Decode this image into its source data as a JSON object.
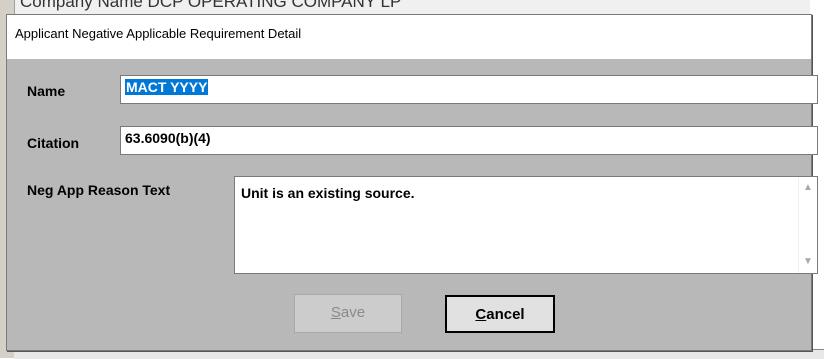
{
  "background": {
    "header_text": "Company Name    DCP OPERATING COMPANY LP"
  },
  "dialog": {
    "title": "Applicant Negative Applicable Requirement Detail",
    "name": {
      "label": "Name",
      "value": "MACT YYYY"
    },
    "citation": {
      "label": "Citation",
      "value": "63.6090(b)(4)"
    },
    "reason": {
      "label": "Neg App Reason Text",
      "value": "Unit is an existing source."
    },
    "buttons": {
      "save": {
        "label": "Save",
        "mnemonic": "S",
        "rest": "ave",
        "enabled": false
      },
      "cancel": {
        "label": "Cancel",
        "mnemonic": "C",
        "rest": "ancel",
        "enabled": true
      }
    }
  }
}
